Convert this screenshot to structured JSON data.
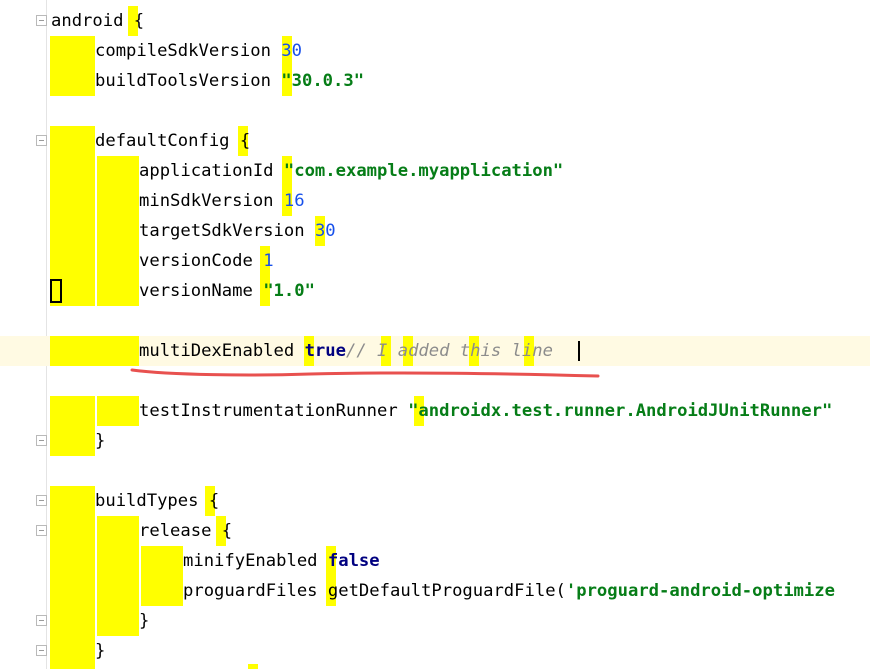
{
  "code_lines": [
    {
      "kind": "plain",
      "t1": "android",
      "t2": " {"
    },
    {
      "kind": "num",
      "t1": "compileSdkVersion",
      "t2": "30"
    },
    {
      "kind": "str",
      "t1": "buildToolsVersion",
      "t2": "\"30.0.3\""
    },
    {
      "kind": "plain",
      "t1": "defaultConfig",
      "t2": " {"
    },
    {
      "kind": "str",
      "t1": "applicationId",
      "t2": "\"com.example.myapplication\""
    },
    {
      "kind": "num",
      "t1": "minSdkVersion",
      "t2": "16"
    },
    {
      "kind": "num",
      "t1": "targetSdkVersion",
      "t2": "30"
    },
    {
      "kind": "num",
      "t1": "versionCode",
      "t2": "1"
    },
    {
      "kind": "str",
      "t1": "versionName",
      "t2": "\"1.0\""
    },
    {
      "kind": "kw",
      "t1": "multiDexEnabled",
      "t2": "true",
      "t3": "// I added this line"
    },
    {
      "kind": "str",
      "t1": "testInstrumentationRunner",
      "t2": "\"androidx.test.runner.AndroidJUnitRunner\""
    },
    {
      "kind": "plain",
      "t1": "}",
      "t2": ""
    },
    {
      "kind": "plain",
      "t1": "buildTypes",
      "t2": " {"
    },
    {
      "kind": "plain",
      "t1": "release",
      "t2": " {"
    },
    {
      "kind": "kw",
      "t1": "minifyEnabled",
      "t2": "false"
    },
    {
      "kind": "call",
      "t1": "proguardFiles",
      "t2": "getDefaultProguardFile(",
      "t3": "'proguard-android-optimize"
    },
    {
      "kind": "plain",
      "t1": "}",
      "t2": ""
    },
    {
      "kind": "plain",
      "t1": "}",
      "t2": ""
    }
  ],
  "annotation": {
    "underline_color": "#e8514f"
  },
  "colors": {
    "indent_highlight": "#ffff00",
    "number": "#1750eb",
    "string": "#067d17",
    "keyword": "#0033b3",
    "comment": "#8c8c8c",
    "current_line": "#fffae3"
  }
}
